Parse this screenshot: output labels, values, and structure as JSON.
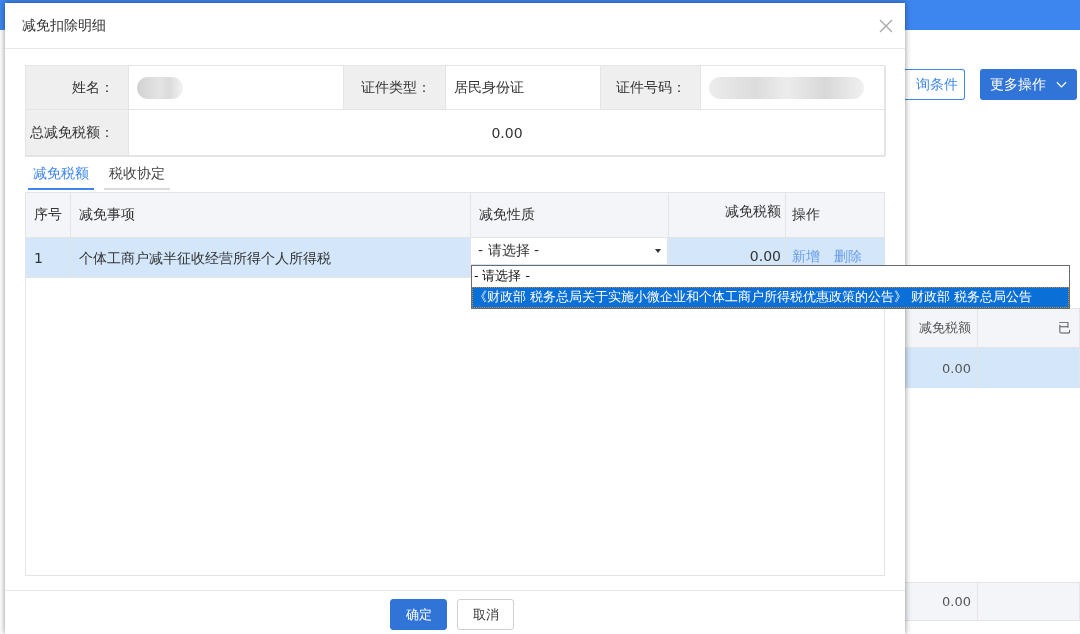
{
  "background": {
    "buttons": [
      {
        "label": "询条件",
        "kind": "outline"
      },
      {
        "label": "更多操作",
        "kind": "primary"
      }
    ],
    "table": {
      "columns": [
        "减免税额",
        "已"
      ],
      "rows": [
        {
          "cells": [
            "0.00",
            ""
          ],
          "selected": true
        }
      ],
      "footer": [
        "0.00"
      ]
    }
  },
  "dialog": {
    "title": "减免扣除明细",
    "fields": [
      {
        "label": "姓名：",
        "kind": "blurred"
      },
      {
        "label": "证件类型：",
        "kind": "text",
        "value": "居民身份证"
      },
      {
        "label": "证件号码：",
        "kind": "blurred"
      }
    ],
    "total": {
      "label": "总减免税额：",
      "value": "0.00"
    },
    "tabs": [
      {
        "label": "减免税额",
        "selected": true
      },
      {
        "label": "税收协定",
        "selected": false
      }
    ],
    "grid": {
      "columns": [
        "序号",
        "减免事项",
        "减免性质",
        "减免税额",
        "操作"
      ],
      "rows": [
        {
          "index": "1",
          "item": "个体工商户减半征收经营所得个人所得税",
          "nature": "- 请选择 -",
          "expanded": true,
          "amount": "0.00",
          "actions": [
            "新增",
            "删除"
          ],
          "selected": true
        }
      ]
    },
    "dropdown": [
      {
        "label": "- 请选择 -",
        "selected": false
      },
      {
        "label": "《财政部 税务总局关于实施小微企业和个体工商户所得税优惠政策的公告》 财政部 税务总局公告",
        "selected": true
      }
    ],
    "buttons": [
      {
        "label": "确定",
        "kind": "primary"
      },
      {
        "label": "取消",
        "kind": "default"
      }
    ]
  }
}
